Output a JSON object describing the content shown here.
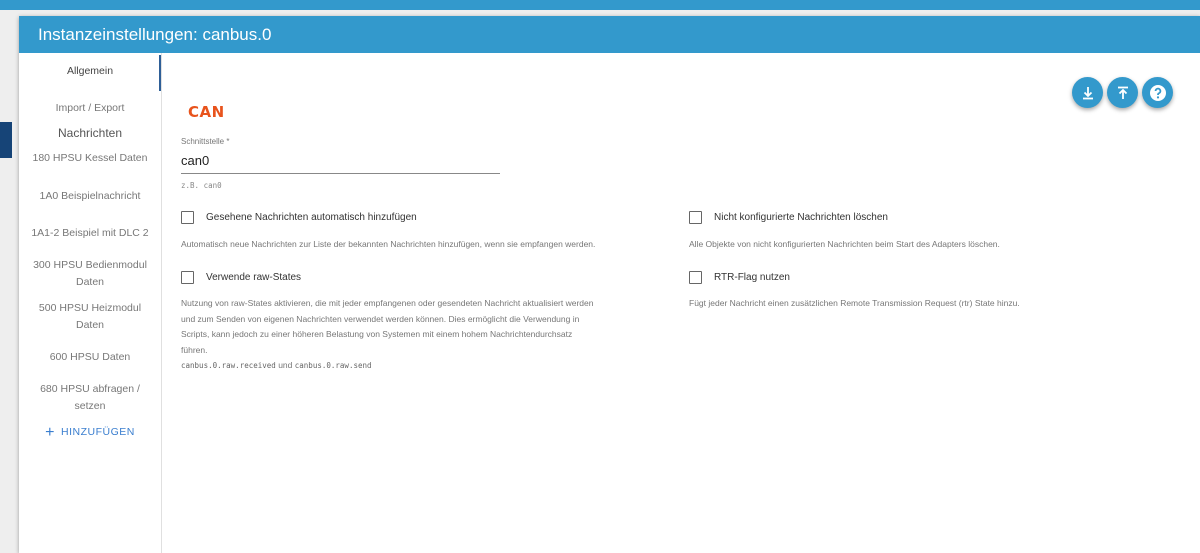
{
  "dialog": {
    "title": "Instanzeinstellungen: canbus.0"
  },
  "sidebar": {
    "items": [
      {
        "label": "Allgemein"
      },
      {
        "label": "Import / Export"
      },
      {
        "label": "Nachrichten"
      },
      {
        "label": "180 HPSU Kessel Daten"
      },
      {
        "label": "1A0 Beispielnachricht"
      },
      {
        "label": "1A1-2 Beispiel mit DLC 2"
      },
      {
        "label": "300 HPSU Bedienmodul Daten"
      },
      {
        "label": "500 HPSU Heizmodul Daten"
      },
      {
        "label": "600 HPSU Daten"
      },
      {
        "label": "680 HPSU abfragen / setzen"
      }
    ],
    "add_label": "HINZUFÜGEN",
    "add_icon": "plus"
  },
  "main": {
    "logo_text": "CAN",
    "interface": {
      "label": "Schnittstelle *",
      "value": "can0",
      "help_prefix": "z.B.",
      "help_code": "can0"
    },
    "options": {
      "auto_add": {
        "label": "Gesehene Nachrichten automatisch hinzufügen",
        "checked": false,
        "description": "Automatisch neue Nachrichten zur Liste der bekannten Nachrichten hinzufügen, wenn sie empfangen werden."
      },
      "delete_unconfigured": {
        "label": "Nicht konfigurierte Nachrichten löschen",
        "checked": false,
        "description": "Alle Objekte von nicht konfigurierten Nachrichten beim Start des Adapters löschen."
      },
      "raw_states": {
        "label": "Verwende raw-States",
        "checked": false,
        "description_lines": [
          "Nutzung von raw-States aktivieren, die mit jeder empfangenen oder gesendeten Nachricht aktualisiert werden",
          "und zum Senden von eigenen Nachrichten verwendet werden können. Dies ermöglicht die Verwendung in",
          "Scripts, kann jedoch zu einer höheren Belastung von Systemen mit einem hohem Nachrichtendurchsatz",
          "führen."
        ],
        "code_received": "canbus.0.raw.received",
        "code_joiner": "und",
        "code_send": "canbus.0.raw.send"
      },
      "rtr_flag": {
        "label": "RTR-Flag nutzen",
        "checked": false,
        "description": "Fügt jeder Nachricht einen zusätzlichen Remote Transmission Request (rtr) State hinzu."
      }
    }
  },
  "actions": [
    {
      "name": "download",
      "icon": "download-icon"
    },
    {
      "name": "upload",
      "icon": "upload-icon"
    },
    {
      "name": "help",
      "icon": "help-icon"
    }
  ],
  "colors": {
    "header": "#3399cc",
    "accent": "#2e5f97",
    "logo": "#e8531c",
    "link": "#3a7ecf"
  }
}
